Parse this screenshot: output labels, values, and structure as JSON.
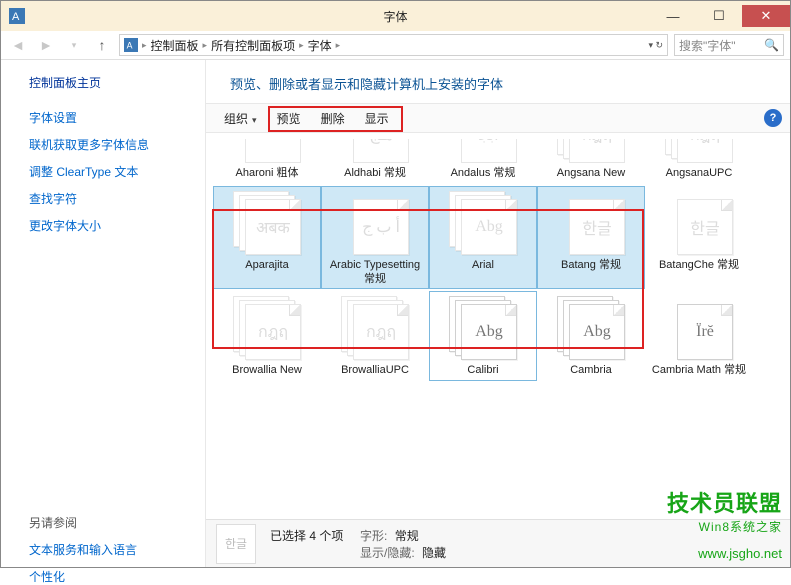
{
  "window": {
    "title": "字体"
  },
  "nav": {
    "breadcrumb": [
      "控制面板",
      "所有控制面板项",
      "字体"
    ],
    "search_placeholder": "搜索\"字体\""
  },
  "sidebar": {
    "home": "控制面板主页",
    "links": [
      "字体设置",
      "联机获取更多字体信息",
      "调整 ClearType 文本",
      "查找字符",
      "更改字体大小"
    ],
    "see_also_title": "另请参阅",
    "see_also": [
      "文本服务和输入语言",
      "个性化"
    ]
  },
  "header": {
    "title": "预览、删除或者显示和隐藏计算机上安装的字体"
  },
  "toolbar": {
    "organize": "组织",
    "preview": "预览",
    "delete": "删除",
    "show": "显示"
  },
  "fonts": [
    {
      "name": "Aharoni 粗体",
      "sample": "ר.פא",
      "faded": true,
      "selected": false,
      "stacks": 1
    },
    {
      "name": "Aldhabi 常规",
      "sample": "هـﺞ",
      "faded": true,
      "selected": false,
      "stacks": 1
    },
    {
      "name": "Andalus 常规",
      "sample": "أﺑﺠ",
      "faded": true,
      "selected": false,
      "stacks": 1
    },
    {
      "name": "Angsana New",
      "sample": "กฎฤ",
      "faded": true,
      "selected": false,
      "stacks": 3
    },
    {
      "name": "AngsanaUPC",
      "sample": "กฎฤ",
      "faded": true,
      "selected": false,
      "stacks": 3
    },
    {
      "name": "Aparajita",
      "sample": "अबक",
      "faded": true,
      "selected": true,
      "stacks": 3
    },
    {
      "name": "Arabic Typesetting 常规",
      "sample": "أ ب ج",
      "faded": true,
      "selected": true,
      "stacks": 1
    },
    {
      "name": "Arial",
      "sample": "Abg",
      "faded": true,
      "selected": true,
      "stacks": 3
    },
    {
      "name": "Batang 常规",
      "sample": "한글",
      "faded": true,
      "selected": true,
      "stacks": 1
    },
    {
      "name": "BatangChe 常规",
      "sample": "한글",
      "faded": true,
      "selected": false,
      "stacks": 1
    },
    {
      "name": "Browallia New",
      "sample": "กฎฤ",
      "faded": true,
      "selected": false,
      "stacks": 3
    },
    {
      "name": "BrowalliaUPC",
      "sample": "กฎฤ",
      "faded": true,
      "selected": false,
      "stacks": 3
    },
    {
      "name": "Calibri",
      "sample": "Abg",
      "faded": false,
      "selected": false,
      "stacks": 3,
      "hover": true
    },
    {
      "name": "Cambria",
      "sample": "Abg",
      "faded": false,
      "selected": false,
      "stacks": 3
    },
    {
      "name": "Cambria Math 常规",
      "sample": "Ϊrĕ",
      "faded": false,
      "selected": false,
      "stacks": 1
    }
  ],
  "status": {
    "thumb_sample": "한글",
    "selected_count": "已选择 4 个项",
    "style_label": "字形:",
    "style_value": "常规",
    "showhide_label": "显示/隐藏:",
    "showhide_value": "隐藏"
  },
  "watermark": {
    "main": "技术员联盟",
    "sub": "Win8系统之家",
    "url": "www.jsgho.net"
  }
}
